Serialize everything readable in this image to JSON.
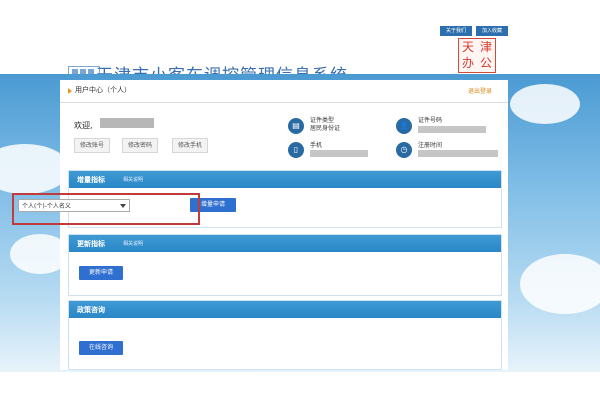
{
  "header": {
    "site_title": "天津市小客车调控管理信息系统",
    "top_links": [
      "关于我们",
      "加入收藏"
    ],
    "seal_chars": [
      "天",
      "津",
      "办",
      "公"
    ]
  },
  "user_center": {
    "title": "用户中心（个人）",
    "logout": "退出登录",
    "greeting": "欢迎,",
    "buttons": [
      "修改账号",
      "修改密码",
      "修改手机"
    ],
    "info": [
      {
        "icon": "id-card-icon",
        "glyph": "▤",
        "label_lines": [
          "证件类型",
          "居民身份证"
        ]
      },
      {
        "icon": "user-icon",
        "glyph": "👤",
        "label_lines": [
          "证件号码"
        ]
      },
      {
        "icon": "phone-icon",
        "glyph": "▯",
        "label_lines": [
          "手机"
        ]
      },
      {
        "icon": "clock-icon",
        "glyph": "◷",
        "label_lines": [
          "注册时间"
        ]
      }
    ]
  },
  "sections": {
    "apply": {
      "title": "增量指标",
      "subtitle": "相关说明",
      "select_value": "个人(个)-个人名义",
      "button": "增量申请"
    },
    "renew": {
      "title": "更新指标",
      "subtitle": "相关说明",
      "button": "更新申请"
    },
    "policy": {
      "title": "政策咨询",
      "button": "在线咨询"
    }
  }
}
